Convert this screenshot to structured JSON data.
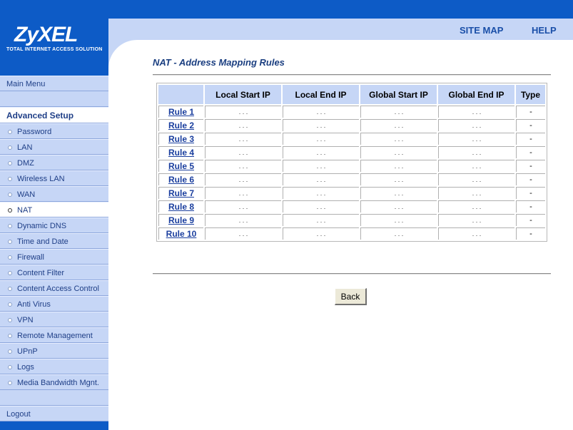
{
  "brand": {
    "logo": "ZyXEL",
    "tagline": "Total Internet Access Solution"
  },
  "header": {
    "site_map": "SITE MAP",
    "help": "HELP"
  },
  "sidebar": {
    "main_menu": "Main Menu",
    "section_title": "Advanced Setup",
    "items": [
      {
        "label": "Password"
      },
      {
        "label": "LAN"
      },
      {
        "label": "DMZ"
      },
      {
        "label": "Wireless LAN"
      },
      {
        "label": "WAN"
      },
      {
        "label": "NAT",
        "active": true
      },
      {
        "label": "Dynamic DNS"
      },
      {
        "label": "Time and Date"
      },
      {
        "label": "Firewall"
      },
      {
        "label": "Content Filter"
      },
      {
        "label": "Content Access Control"
      },
      {
        "label": "Anti Virus"
      },
      {
        "label": "VPN"
      },
      {
        "label": "Remote Management"
      },
      {
        "label": "UPnP"
      },
      {
        "label": "Logs"
      },
      {
        "label": "Media Bandwidth Mgnt."
      }
    ],
    "logout": "Logout"
  },
  "main": {
    "title": "NAT - Address Mapping Rules",
    "columns": [
      "",
      "Local Start IP",
      "Local End IP",
      "Global Start IP",
      "Global End IP",
      "Type"
    ],
    "rows": [
      {
        "rule": "Rule 1",
        "local_start": ". . .",
        "local_end": ". . .",
        "global_start": ". . .",
        "global_end": ". . .",
        "type": "-"
      },
      {
        "rule": "Rule 2",
        "local_start": ". . .",
        "local_end": ". . .",
        "global_start": ". . .",
        "global_end": ". . .",
        "type": "-"
      },
      {
        "rule": "Rule 3",
        "local_start": ". . .",
        "local_end": ". . .",
        "global_start": ". . .",
        "global_end": ". . .",
        "type": "-"
      },
      {
        "rule": "Rule 4",
        "local_start": ". . .",
        "local_end": ". . .",
        "global_start": ". . .",
        "global_end": ". . .",
        "type": "-"
      },
      {
        "rule": "Rule 5",
        "local_start": ". . .",
        "local_end": ". . .",
        "global_start": ". . .",
        "global_end": ". . .",
        "type": "-"
      },
      {
        "rule": "Rule 6",
        "local_start": ". . .",
        "local_end": ". . .",
        "global_start": ". . .",
        "global_end": ". . .",
        "type": "-"
      },
      {
        "rule": "Rule 7",
        "local_start": ". . .",
        "local_end": ". . .",
        "global_start": ". . .",
        "global_end": ". . .",
        "type": "-"
      },
      {
        "rule": "Rule 8",
        "local_start": ". . .",
        "local_end": ". . .",
        "global_start": ". . .",
        "global_end": ". . .",
        "type": "-"
      },
      {
        "rule": "Rule 9",
        "local_start": ". . .",
        "local_end": ". . .",
        "global_start": ". . .",
        "global_end": ". . .",
        "type": "-"
      },
      {
        "rule": "Rule 10",
        "local_start": ". . .",
        "local_end": ". . .",
        "global_start": ". . .",
        "global_end": ". . .",
        "type": "-"
      }
    ],
    "back_button": "Back"
  },
  "colors": {
    "brand_blue": "#0d5bc6",
    "panel_light_blue": "#c6d6f6",
    "link_blue": "#1a3e9e"
  }
}
